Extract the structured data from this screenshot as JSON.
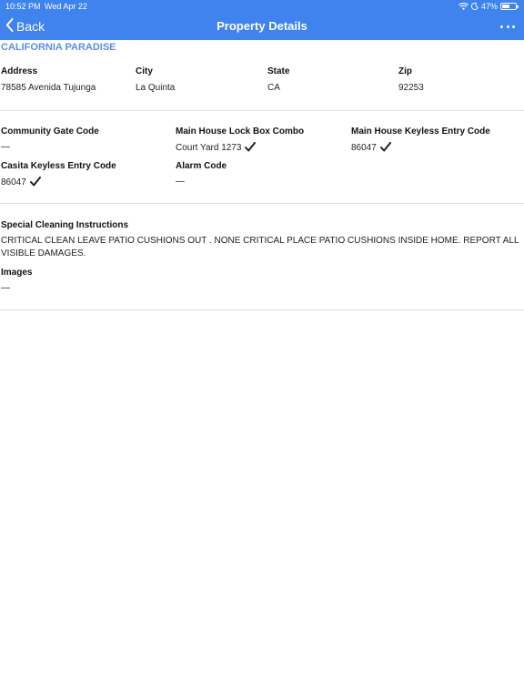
{
  "status": {
    "time": "10:52 PM",
    "date": "Wed Apr 22",
    "battery": "47%",
    "battery_level": 0.47,
    "icons": [
      "wifi-icon",
      "moon-icon",
      "battery-icon"
    ]
  },
  "nav": {
    "back_label": "Back",
    "title": "Property Details",
    "more_icon": "more-icon"
  },
  "property": {
    "name": "CALIFORNIA PARADISE",
    "address_label": "Address",
    "address": "78585 Avenida Tujunga",
    "city_label": "City",
    "city": "La Quinta",
    "state_label": "State",
    "state": "CA",
    "zip_label": "Zip",
    "zip": "92253"
  },
  "codes": {
    "community_gate_label": "Community Gate Code",
    "community_gate": "—",
    "lockbox_label": "Main House Lock Box Combo",
    "lockbox": "Court Yard 1273",
    "keyless_label": "Main House Keyless Entry Code",
    "keyless": "86047",
    "casita_label": "Casita Keyless Entry Code",
    "casita": "86047",
    "alarm_label": "Alarm Code",
    "alarm": "—"
  },
  "cleaning": {
    "label": "Special Cleaning Instructions",
    "text": "CRITICAL CLEAN LEAVE PATIO CUSHIONS OUT . NONE CRITICAL PLACE PATIO CUSHIONS INSIDE HOME. REPORT ALL VISIBLE DAMAGES.",
    "images_label": "Images",
    "images": "—"
  },
  "colors": {
    "nav_background": "#3f83ef",
    "accent_text": "#5b8fe6"
  }
}
